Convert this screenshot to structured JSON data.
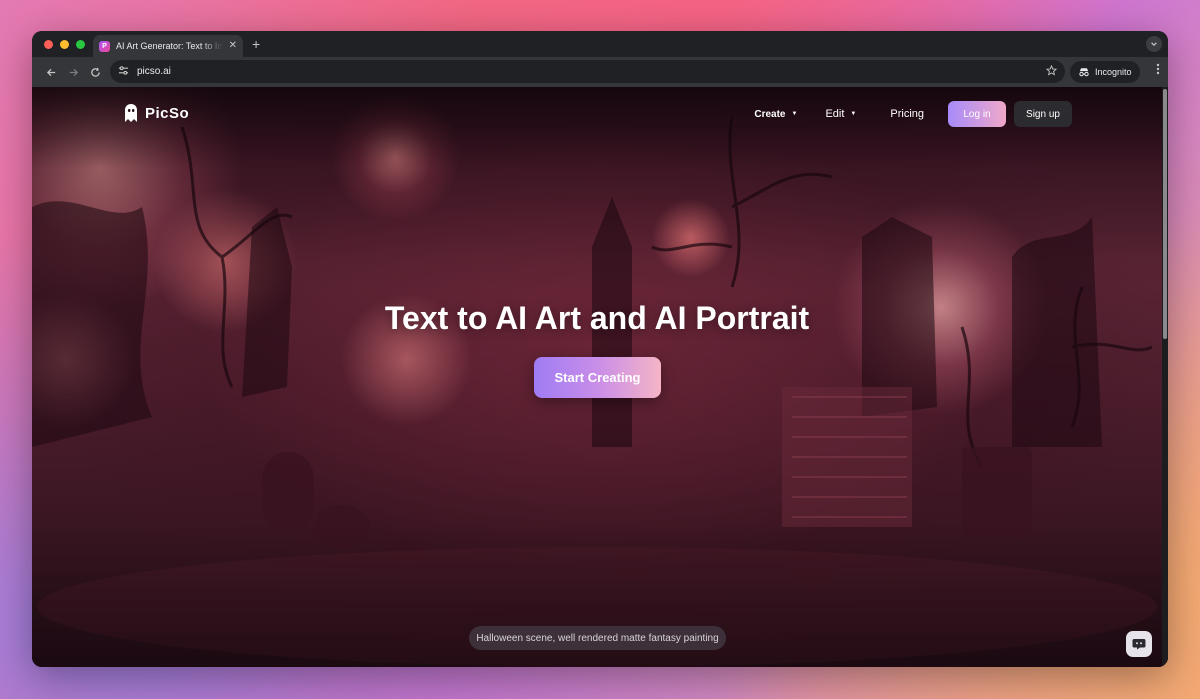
{
  "browser": {
    "tab_title": "AI Art Generator: Text to Image",
    "tab_close_glyph": "✕",
    "new_tab_glyph": "+",
    "url": "picso.ai",
    "profile_label": "Incognito",
    "icons": {
      "back": "arrow-left-icon",
      "forward": "arrow-right-icon",
      "reload": "reload-icon",
      "site_info": "tune-icon",
      "bookmark": "star-icon",
      "incognito": "incognito-icon",
      "menu": "kebab-icon",
      "tab_search": "chevron-down-icon"
    }
  },
  "site": {
    "logo_text": "PicSo",
    "nav": {
      "create_label": "Create",
      "edit_label": "Edit",
      "pricing_label": "Pricing",
      "login_label": "Log in",
      "signup_label": "Sign up"
    },
    "hero": {
      "title": "Text to AI Art and AI Portrait",
      "cta_label": "Start Creating",
      "caption": "Halloween scene, well rendered matte fantasy painting"
    },
    "colors": {
      "accent_start": "#9f7cf4",
      "accent_end": "#f5b4c6"
    }
  }
}
